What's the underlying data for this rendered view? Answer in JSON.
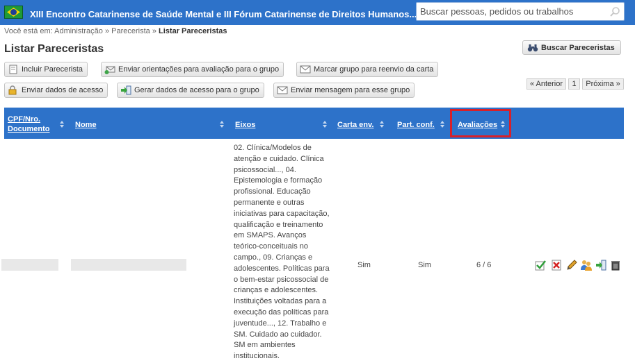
{
  "header": {
    "title": "XIII Encontro Catarinense de Saúde Mental e III Fórum Catarinense de Direitos Humanos...",
    "flag_icon": "brazil-flag-icon",
    "search_placeholder": "Buscar pessoas, pedidos ou trabalhos",
    "accent_color": "#2d72c9"
  },
  "breadcrumb": {
    "prefix": "Você está em:",
    "items": [
      "Administração",
      "Parecerista"
    ],
    "separator": "»",
    "current": "Listar Pareceristas"
  },
  "page": {
    "title": "Listar Pareceristas"
  },
  "toolbar": {
    "search_button": "Buscar Pareceristas",
    "buttons": [
      {
        "label": "Incluir Parecerista",
        "icon": "add-document-icon"
      },
      {
        "label": "Enviar orientações para avaliação para o grupo",
        "icon": "send-group-icon"
      },
      {
        "label": "Marcar grupo para reenvio da carta",
        "icon": "envelope-icon"
      },
      {
        "label": "Enviar dados de acesso",
        "icon": "key-lock-icon"
      },
      {
        "label": "Gerar dados de acesso para o grupo",
        "icon": "export-icon"
      },
      {
        "label": "Enviar mensagem para esse grupo",
        "icon": "envelope-icon"
      }
    ]
  },
  "pagination": {
    "prev": "« Anterior",
    "page": "1",
    "next": "Próxima »"
  },
  "table": {
    "columns": [
      "CPF/Nro. Documento",
      "Nome",
      "Eixos",
      "Carta env.",
      "Part. conf.",
      "Avaliações"
    ],
    "highlighted_column": "Avaliações",
    "rows": [
      {
        "cpf": "",
        "nome": "",
        "eixos": "02. Clínica/Modelos de atenção e cuidado. Clínica psicossocial..., 04. Epistemologia e formação profissional. Educação permanente e outras iniciativas para capacitação, qualificação e treinamento em SMAPS. Avanços teórico-conceituais no campo., 09. Crianças e adolescentes. Políticas para o bem-estar psicossocial de crianças e adolescentes. Instituições voltadas para a execução das políticas para juventude..., 12. Trabalho e SM. Cuidado ao cuidador. SM em ambientes institucionais.",
        "carta_env": "Sim",
        "part_conf": "Sim",
        "avaliacoes": "6 / 6",
        "actions": [
          "confirm-check-icon",
          "cancel-x-icon",
          "edit-pencil-icon",
          "users-group-icon",
          "login-arrow-icon",
          "trash-icon"
        ]
      }
    ]
  }
}
